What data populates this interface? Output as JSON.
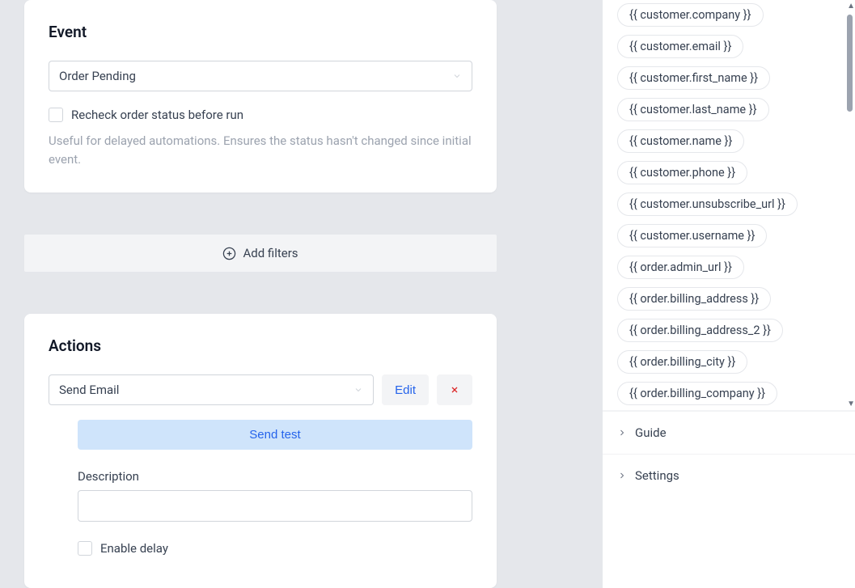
{
  "event": {
    "title": "Event",
    "select_value": "Order Pending",
    "recheck_label": "Recheck order status before run",
    "recheck_help": "Useful for delayed automations. Ensures the status hasn't changed since initial event."
  },
  "filters": {
    "add_label": "Add filters"
  },
  "actions": {
    "title": "Actions",
    "select_value": "Send Email",
    "edit_label": "Edit",
    "send_test_label": "Send test",
    "description_label": "Description",
    "description_value": "",
    "enable_delay_label": "Enable delay"
  },
  "sidebar": {
    "variables": [
      "{{ customer.company }}",
      "{{ customer.email }}",
      "{{ customer.first_name }}",
      "{{ customer.last_name }}",
      "{{ customer.name }}",
      "{{ customer.phone }}",
      "{{ customer.unsubscribe_url }}",
      "{{ customer.username }}",
      "{{ order.admin_url }}",
      "{{ order.billing_address }}",
      "{{ order.billing_address_2 }}",
      "{{ order.billing_city }}",
      "{{ order.billing_company }}"
    ],
    "guide_label": "Guide",
    "settings_label": "Settings"
  }
}
